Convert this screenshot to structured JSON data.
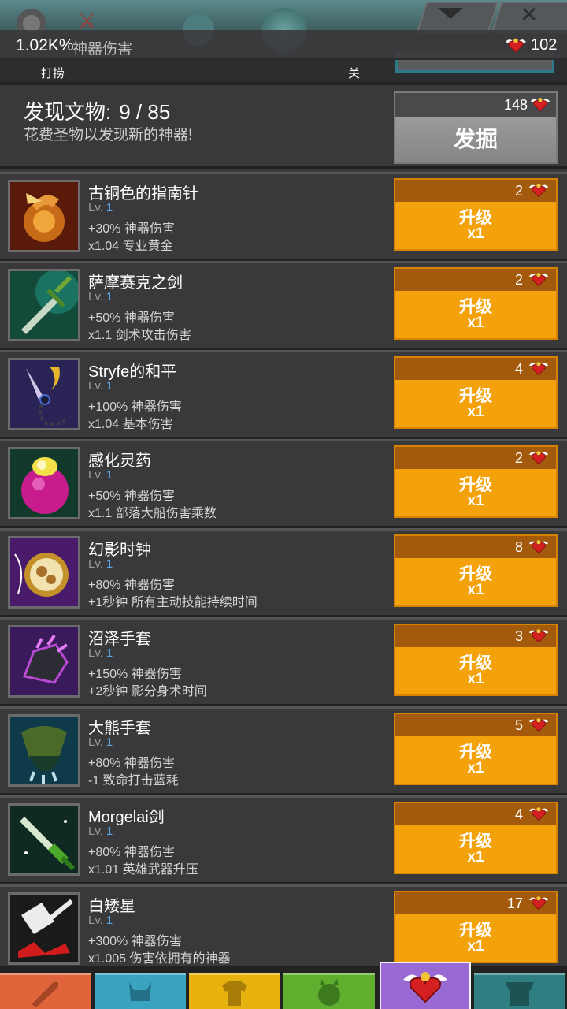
{
  "top": {
    "left_label": "打捞",
    "right_label": "关"
  },
  "status": {
    "damage_value": "1.02K%",
    "damage_label": "神器伤害",
    "relics": "102"
  },
  "discover": {
    "title": "发现文物:",
    "count": "9 / 85",
    "subtitle": "花费圣物以发现新的神器!",
    "cost": "148",
    "button": "发掘"
  },
  "artifacts": [
    {
      "name": "古铜色的指南针",
      "lv_label": "Lv.",
      "lv": "1",
      "effect1": "+30% 神器伤害",
      "effect2": "x1.04 专业黄金",
      "cost": "2",
      "action": "升级",
      "mult": "x1"
    },
    {
      "name": "萨摩赛克之剑",
      "lv_label": "Lv.",
      "lv": "1",
      "effect1": "+50% 神器伤害",
      "effect2": "x1.1 剑术攻击伤害",
      "cost": "2",
      "action": "升级",
      "mult": "x1"
    },
    {
      "name": "Stryfe的和平",
      "lv_label": "Lv.",
      "lv": "1",
      "effect1": "+100% 神器伤害",
      "effect2": "x1.04 基本伤害",
      "cost": "4",
      "action": "升级",
      "mult": "x1"
    },
    {
      "name": "感化灵药",
      "lv_label": "Lv.",
      "lv": "1",
      "effect1": "+50% 神器伤害",
      "effect2": "x1.1 部落大船伤害乘数",
      "cost": "2",
      "action": "升级",
      "mult": "x1"
    },
    {
      "name": "幻影时钟",
      "lv_label": "Lv.",
      "lv": "1",
      "effect1": "+80% 神器伤害",
      "effect2": "+1秒钟 所有主动技能持续时间",
      "cost": "8",
      "action": "升级",
      "mult": "x1"
    },
    {
      "name": "沼泽手套",
      "lv_label": "Lv.",
      "lv": "1",
      "effect1": "+150% 神器伤害",
      "effect2": "+2秒钟 影分身术时间",
      "cost": "3",
      "action": "升级",
      "mult": "x1"
    },
    {
      "name": "大熊手套",
      "lv_label": "Lv.",
      "lv": "1",
      "effect1": "+80% 神器伤害",
      "effect2": "-1 致命打击蓝耗",
      "cost": "5",
      "action": "升级",
      "mult": "x1"
    },
    {
      "name": "Morgelai剑",
      "lv_label": "Lv.",
      "lv": "1",
      "effect1": "+80% 神器伤害",
      "effect2": "x1.01 英雄武器升压",
      "cost": "4",
      "action": "升级",
      "mult": "x1"
    },
    {
      "name": "白矮星",
      "lv_label": "Lv.",
      "lv": "1",
      "effect1": "+300% 神器伤害",
      "effect2": "x1.005 伤害依拥有的神器",
      "cost": "17",
      "action": "升级",
      "mult": "x1"
    }
  ],
  "icons": {
    "artifacts": [
      "compass-icon",
      "sword-icon",
      "chain-scepter-icon",
      "potion-icon",
      "pocket-watch-icon",
      "gauntlet-icon",
      "bear-claw-icon",
      "green-sword-icon",
      "hammer-icon"
    ],
    "nav": [
      "sword-tab-icon",
      "hero-helmet-tab-icon",
      "shirt-tab-icon",
      "pet-tab-icon",
      "artifact-heart-tab-icon",
      "shop-tab-icon"
    ]
  },
  "colors": {
    "upgrade_button": "#f3a20c",
    "upgrade_cost_bar": "#a45a0d",
    "level_number": "#5aa8e8",
    "dig_button": "#8c8c8c",
    "nav": [
      "#e0643a",
      "#3aa3bf",
      "#e8b20e",
      "#5fae2e",
      "#9a6ad4",
      "#2f7f82"
    ]
  }
}
